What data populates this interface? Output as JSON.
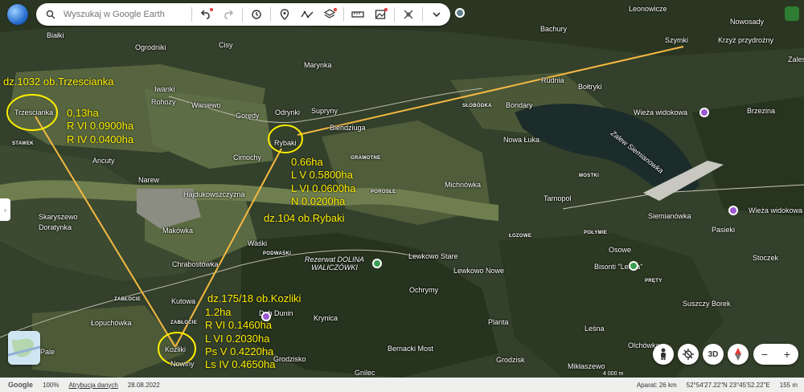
{
  "search": {
    "placeholder": "Wyszukaj w Google Earth"
  },
  "toolbar": {
    "icons": [
      "undo-icon",
      "redo-icon",
      "history-icon",
      "placemark-icon",
      "path-icon",
      "layers-icon",
      "ruler-icon",
      "image-icon",
      "project-icon",
      "chevron-down-icon"
    ]
  },
  "colors": {
    "annotation": "#ffee00",
    "route": "#f5b942"
  },
  "places": [
    {
      "name": "Białki",
      "cls": ""
    },
    {
      "name": "Ogrodniki",
      "cls": ""
    },
    {
      "name": "Cisy",
      "cls": ""
    },
    {
      "name": "Marynka",
      "cls": ""
    },
    {
      "name": "Iwanki",
      "cls": ""
    },
    {
      "name": "Rohozy",
      "cls": ""
    },
    {
      "name": "Waniewo",
      "cls": ""
    },
    {
      "name": "Odrynki",
      "cls": ""
    },
    {
      "name": "Suprуny",
      "cls": ""
    },
    {
      "name": "Gorędy",
      "cls": ""
    },
    {
      "name": "Bieńdziuga",
      "cls": ""
    },
    {
      "name": "Cimochy",
      "cls": ""
    },
    {
      "name": "Ancuty",
      "cls": ""
    },
    {
      "name": "Narew",
      "cls": ""
    },
    {
      "name": "Hajdukowszczyzna",
      "cls": ""
    },
    {
      "name": "Skaryszewo",
      "cls": ""
    },
    {
      "name": "Doratynka",
      "cls": ""
    },
    {
      "name": "Makówka",
      "cls": ""
    },
    {
      "name": "Waśki",
      "cls": ""
    },
    {
      "name": "Chrabostówka",
      "cls": ""
    },
    {
      "name": "Kutowa",
      "cls": ""
    },
    {
      "name": "Łopuchówka",
      "cls": ""
    },
    {
      "name": "Nowiny",
      "cls": ""
    },
    {
      "name": "Krynica",
      "cls": ""
    },
    {
      "name": "Ochrymy",
      "cls": ""
    },
    {
      "name": "Lewkowo Stare",
      "cls": ""
    },
    {
      "name": "Lewkowo Nowe",
      "cls": ""
    },
    {
      "name": "Michnówka",
      "cls": ""
    },
    {
      "name": "Nowa Łuka",
      "cls": ""
    },
    {
      "name": "Tarnopol",
      "cls": ""
    },
    {
      "name": "Rudnia",
      "cls": ""
    },
    {
      "name": "Bołtryki",
      "cls": ""
    },
    {
      "name": "Bondary",
      "cls": ""
    },
    {
      "name": "Bachury",
      "cls": ""
    },
    {
      "name": "Leonowicze",
      "cls": ""
    },
    {
      "name": "Szymki",
      "cls": ""
    },
    {
      "name": "Krzyż przydrożny",
      "cls": ""
    },
    {
      "name": "Nowosady",
      "cls": ""
    },
    {
      "name": "Zales",
      "cls": ""
    },
    {
      "name": "Wieża widokowa",
      "cls": ""
    },
    {
      "name": "Brzezina",
      "cls": ""
    },
    {
      "name": "Siemianówka",
      "cls": ""
    },
    {
      "name": "Wieża widokowa",
      "cls": ""
    },
    {
      "name": "Pasieki",
      "cls": ""
    },
    {
      "name": "Osowe",
      "cls": ""
    },
    {
      "name": "Stoczek",
      "cls": ""
    },
    {
      "name": "Bisonti \"Leśna\"",
      "cls": ""
    },
    {
      "name": "Suszczy Borek",
      "cls": ""
    },
    {
      "name": "Planta",
      "cls": ""
    },
    {
      "name": "Leśna",
      "cls": ""
    },
    {
      "name": "Olchówka",
      "cls": ""
    },
    {
      "name": "Bernacki Most",
      "cls": ""
    },
    {
      "name": "Grodzisk",
      "cls": ""
    },
    {
      "name": "Mikłaszewo",
      "cls": ""
    },
    {
      "name": "Gnilec",
      "cls": ""
    },
    {
      "name": "Dąb Dunin",
      "cls": ""
    },
    {
      "name": "Grodzisko",
      "cls": ""
    },
    {
      "name": "Zalew Siemianowka",
      "cls": ""
    },
    {
      "name": "Rezerwat DOLINA WALICZÓWKI",
      "cls": "reserve"
    },
    {
      "name": "STAWEK",
      "cls": "small"
    },
    {
      "name": "GRAMOTNE",
      "cls": "small"
    },
    {
      "name": "POROSŁE",
      "cls": "small"
    },
    {
      "name": "PODWAŚKI",
      "cls": "small"
    },
    {
      "name": "ZABŁOCIE",
      "cls": "small"
    },
    {
      "name": "ŁOZOWE",
      "cls": "small"
    },
    {
      "name": "POŁYMIE",
      "cls": "small"
    },
    {
      "name": "PRĘTY",
      "cls": "small"
    },
    {
      "name": "MOSTKI",
      "cls": "small"
    },
    {
      "name": "SŁOBÓDKA",
      "cls": "small"
    },
    {
      "name": "ZABŁOCIE",
      "cls": "small"
    },
    {
      "name": "Pale",
      "cls": ""
    }
  ],
  "villages_circled": [
    {
      "name": "Trzescianka"
    },
    {
      "name": "Rybaki"
    },
    {
      "name": "Kozliki"
    }
  ],
  "annotations": {
    "trzescianka": {
      "title": "dz.1032 ob.Trzescianka",
      "lines": [
        "0,13ha",
        "R VI 0.0900ha",
        "R IV 0.0400ha"
      ]
    },
    "rybaki": {
      "lines": [
        "0.66ha",
        "L V 0.5800ha",
        "L VI 0.0600ha",
        "N 0.0200ha"
      ],
      "title": "dz.104 ob.Rybaki"
    },
    "kozliki": {
      "title": "dz.175/18 ob.Kozliki",
      "lines": [
        "1.2ha",
        "R VI 0.1460ha",
        "L VI 0.2030ha",
        "Ps V 0.4220ha",
        "Ls IV 0.4650ha"
      ]
    }
  },
  "map_controls": {
    "three_d": "3D",
    "zoom_in": "+",
    "zoom_out": "−"
  },
  "scale": {
    "label": "4 000 m"
  },
  "status": {
    "brand": "Google",
    "zoom": "100%",
    "attribution": "Atrybucja danych",
    "date": "28.08.2022",
    "camera": "Aparat: 26 km",
    "coords": "52°54'27.22\"N 23°45'52.22\"E",
    "elevation": "155 m"
  }
}
